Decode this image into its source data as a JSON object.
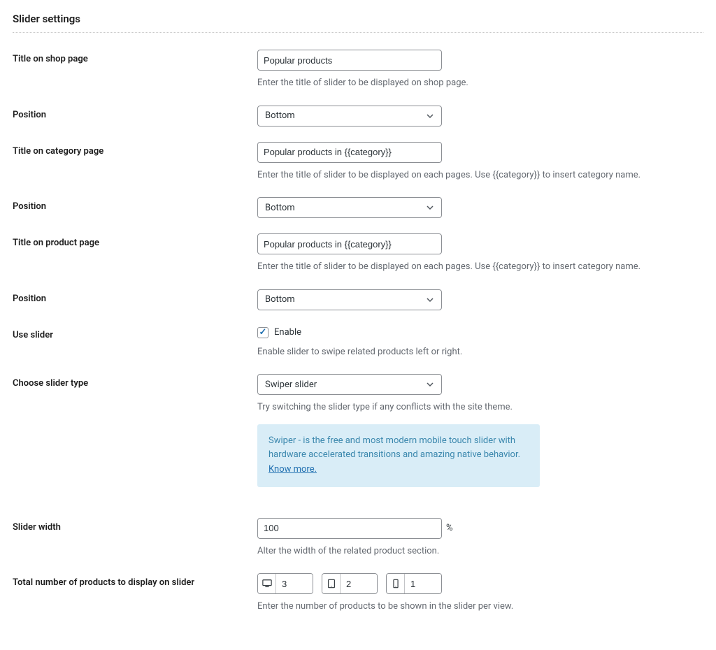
{
  "section_title": "Slider settings",
  "fields": {
    "shop_title": {
      "label": "Title on shop page",
      "value": "Popular products",
      "help": "Enter the title of slider to be displayed on shop page."
    },
    "shop_position": {
      "label": "Position",
      "value": "Bottom"
    },
    "category_title": {
      "label": "Title on category page",
      "value": "Popular products in {{category}}",
      "help": "Enter the title of slider to be displayed on each pages. Use {{category}} to insert category name."
    },
    "category_position": {
      "label": "Position",
      "value": "Bottom"
    },
    "product_title": {
      "label": "Title on product page",
      "value": "Popular products in {{category}}",
      "help": "Enter the title of slider to be displayed on each pages. Use {{category}} to insert category name."
    },
    "product_position": {
      "label": "Position",
      "value": "Bottom"
    },
    "use_slider": {
      "label": "Use slider",
      "checkbox_label": "Enable",
      "help": "Enable slider to swipe related products left or right."
    },
    "slider_type": {
      "label": "Choose slider type",
      "value": "Swiper slider",
      "help": "Try switching the slider type if any conflicts with the site theme."
    },
    "slider_info": {
      "text": "Swiper - is the free and most modern mobile touch slider with hardware accelerated transitions and amazing native behavior. ",
      "link_text": "Know more."
    },
    "slider_width": {
      "label": "Slider width",
      "value": "100",
      "suffix": "%",
      "help": "Alter the width of the related product section."
    },
    "total_products": {
      "label": "Total number of products to display on slider",
      "desktop": "3",
      "tablet": "2",
      "mobile": "1",
      "help": "Enter the number of products to be shown in the slider per view."
    }
  }
}
